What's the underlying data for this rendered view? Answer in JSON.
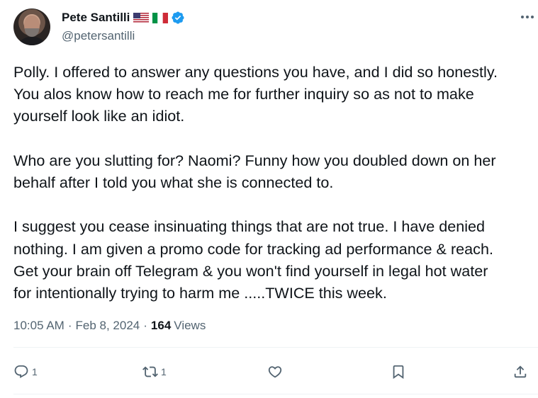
{
  "author": {
    "display_name": "Pete Santilli",
    "handle": "@petersantilli",
    "flags": [
      "us-flag-icon",
      "italy-flag-icon"
    ],
    "verified": true
  },
  "tweet": {
    "paragraphs": [
      "Polly.  I offered to answer any questions you have, and I did so honestly.\nYou alos know how to reach me for further inquiry so as not to make\nyourself look like an idiot.",
      "Who are you slutting for?  Naomi?  Funny how you doubled down on her\nbehalf after I told you what she is connected to.",
      "I suggest you cease insinuating things that are not true.  I have denied\nnothing.  I am given a promo code for tracking ad performance & reach.\nGet your brain off Telegram & you won't find yourself in legal hot water\nfor intentionally trying to harm me .....TWICE this week."
    ],
    "time": "10:05 AM",
    "separator": "·",
    "date": "Feb 8, 2024",
    "views_count": "164",
    "views_label": "Views"
  },
  "actions": {
    "reply_count": "1",
    "repost_count": "1",
    "like_count": "",
    "icons": [
      "reply-icon",
      "repost-icon",
      "like-icon",
      "bookmark-icon",
      "share-icon"
    ]
  },
  "colors": {
    "text": "#0f1419",
    "secondary": "#536471",
    "verified": "#1d9bf0",
    "divider": "#eff3f4"
  }
}
